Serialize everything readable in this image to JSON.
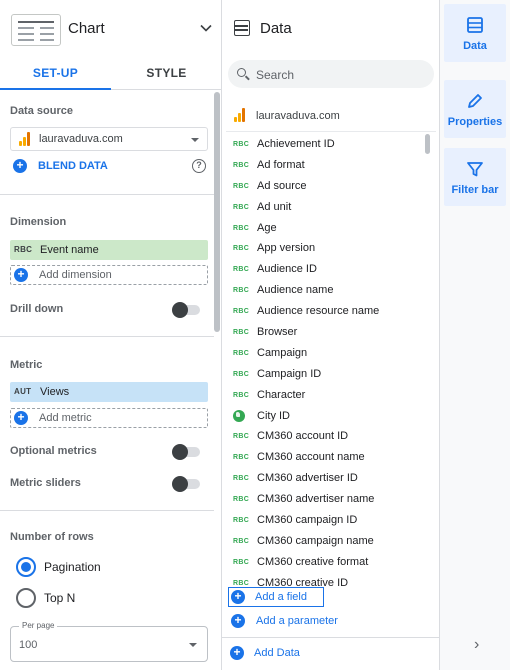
{
  "chart_panel": {
    "title": "Chart",
    "tabs": [
      "SET-UP",
      "STYLE"
    ],
    "data_source": {
      "label": "Data source",
      "value": "lauravaduva.com",
      "blend_label": "BLEND DATA"
    },
    "dimension": {
      "label": "Dimension",
      "chip_type": "RBC",
      "chip_name": "Event name",
      "add_label": "Add dimension"
    },
    "drill_down_label": "Drill down",
    "metric": {
      "label": "Metric",
      "chip_type": "AUT",
      "chip_name": "Views",
      "add_label": "Add metric"
    },
    "optional_metrics_label": "Optional metrics",
    "metric_sliders_label": "Metric sliders",
    "rows": {
      "label": "Number of rows",
      "options": [
        "Pagination",
        "Top N"
      ],
      "selected": "Pagination",
      "per_page_label": "Per page",
      "per_page_value": "100"
    }
  },
  "data_panel": {
    "title": "Data",
    "search_placeholder": "Search",
    "source_name": "lauravaduva.com",
    "field_type_label": "RBC",
    "fields": [
      {
        "name": "Achievement ID",
        "icon": "text-type-icon"
      },
      {
        "name": "Ad format",
        "icon": "text-type-icon"
      },
      {
        "name": "Ad source",
        "icon": "text-type-icon"
      },
      {
        "name": "Ad unit",
        "icon": "text-type-icon"
      },
      {
        "name": "Age",
        "icon": "text-type-icon"
      },
      {
        "name": "App version",
        "icon": "text-type-icon"
      },
      {
        "name": "Audience ID",
        "icon": "text-type-icon"
      },
      {
        "name": "Audience name",
        "icon": "text-type-icon"
      },
      {
        "name": "Audience resource name",
        "icon": "text-type-icon"
      },
      {
        "name": "Browser",
        "icon": "text-type-icon"
      },
      {
        "name": "Campaign",
        "icon": "text-type-icon"
      },
      {
        "name": "Campaign ID",
        "icon": "text-type-icon"
      },
      {
        "name": "Character",
        "icon": "text-type-icon"
      },
      {
        "name": "City ID",
        "icon": "globe-icon"
      },
      {
        "name": "CM360 account ID",
        "icon": "text-type-icon"
      },
      {
        "name": "CM360 account name",
        "icon": "text-type-icon"
      },
      {
        "name": "CM360 advertiser ID",
        "icon": "text-type-icon"
      },
      {
        "name": "CM360 advertiser name",
        "icon": "text-type-icon"
      },
      {
        "name": "CM360 campaign ID",
        "icon": "text-type-icon"
      },
      {
        "name": "CM360 campaign name",
        "icon": "text-type-icon"
      },
      {
        "name": "CM360 creative format",
        "icon": "text-type-icon"
      },
      {
        "name": "CM360 creative ID",
        "icon": "text-type-icon"
      }
    ],
    "add_field_label": "Add a field",
    "add_parameter_label": "Add a parameter",
    "add_data_label": "Add Data"
  },
  "rail": {
    "buttons": [
      {
        "label": "Data",
        "icon": "table-icon"
      },
      {
        "label": "Properties",
        "icon": "pencil-icon"
      },
      {
        "label": "Filter bar",
        "icon": "filter-icon"
      }
    ]
  },
  "colors": {
    "accent": "#1a73e8",
    "dimension_chip": "#cce8c9",
    "metric_chip": "#c6e2f7",
    "dimension_type": "#34a853"
  }
}
